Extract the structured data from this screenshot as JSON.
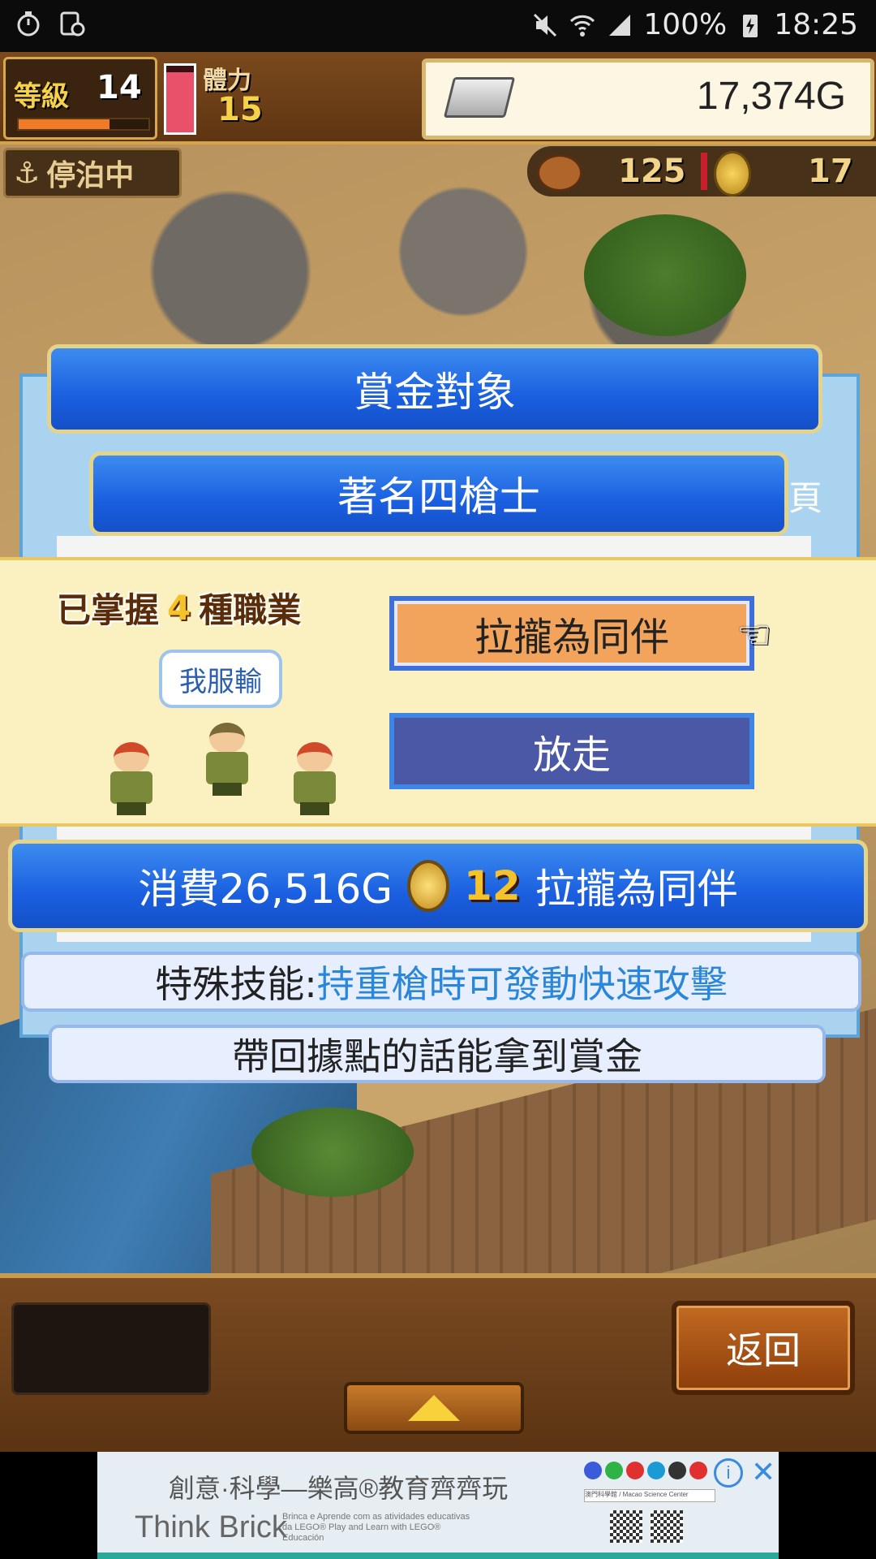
{
  "status_bar": {
    "battery": "100%",
    "time": "18:25",
    "icons": [
      "stopwatch-icon",
      "screenshot-icon",
      "mute-icon",
      "wifi-icon",
      "signal-icon",
      "battery-charging-icon"
    ]
  },
  "hud": {
    "level_label": "等級",
    "level_value": "14",
    "level_progress": 0.7,
    "hp_fill": 0.9,
    "stamina_label": "體力",
    "stamina_value": "15",
    "gold": "17,374G",
    "status": "停泊中",
    "food": "125",
    "coins": "17"
  },
  "dialog": {
    "title": "賞金對象",
    "name": "著名四槍士",
    "page_suffix": "頁"
  },
  "popup": {
    "mastered_prefix": "已掌握",
    "mastered_count": "4",
    "mastered_suffix": "種職業",
    "speech": "我服輸",
    "recruit_button": "拉攏為同伴",
    "release_button": "放走"
  },
  "cost": {
    "prefix": "消費26,516G",
    "coin_count": "12",
    "suffix": "拉攏為同伴"
  },
  "skill": {
    "label": "特殊技能:",
    "value": "持重槍時可發動快速攻擊"
  },
  "bounty_note": "帶回據點的話能拿到賞金",
  "bottom": {
    "back_button": "返回"
  },
  "ad": {
    "headline": "創意·科學—樂高®教育齊齊玩",
    "brand": "Think Brick",
    "small_text": "Brinca e Aprende com as atividades educativas da LEGO® Play and Learn with LEGO® Educación",
    "search_text": "澳門科學館 / Macao Science Center",
    "colors": [
      "#3b5bdb",
      "#2fb344",
      "#e03131",
      "#1c9ad6",
      "#333333",
      "#e03131"
    ]
  },
  "colors": {
    "ribbon_blue": "#1a5fe0",
    "popup_bg": "#fbf0c0",
    "recruit_bg": "#f2a45c",
    "release_bg": "#4a58a6"
  }
}
